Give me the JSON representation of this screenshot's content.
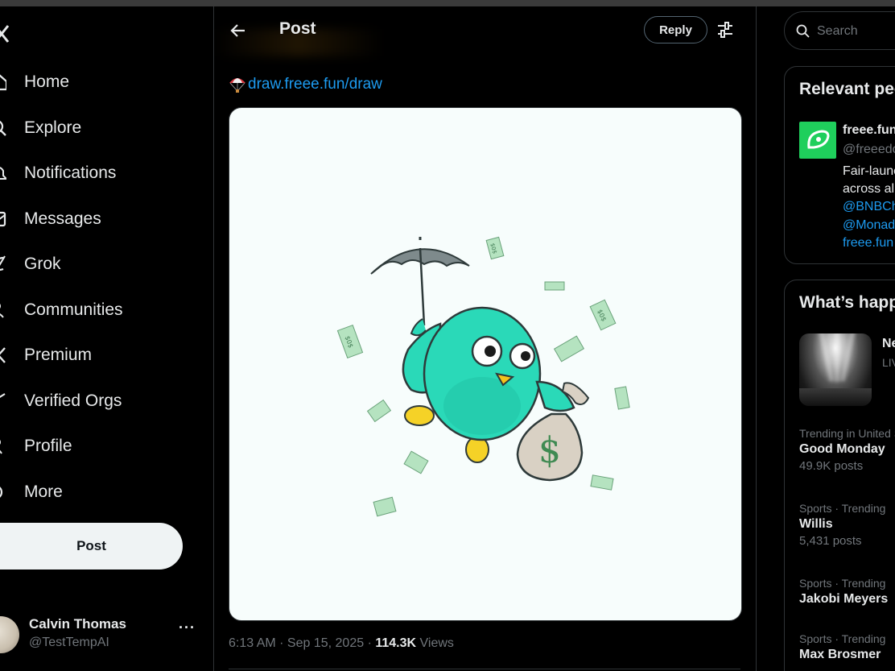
{
  "nav": {
    "items": [
      {
        "label": "Home",
        "icon": "home-icon"
      },
      {
        "label": "Explore",
        "icon": "search-icon"
      },
      {
        "label": "Notifications",
        "icon": "bell-icon"
      },
      {
        "label": "Messages",
        "icon": "envelope-icon"
      },
      {
        "label": "Grok",
        "icon": "grok-icon"
      },
      {
        "label": "Communities",
        "icon": "people-icon"
      },
      {
        "label": "Premium",
        "icon": "x-logo-icon"
      },
      {
        "label": "Verified Orgs",
        "icon": "lightning-icon"
      },
      {
        "label": "Profile",
        "icon": "person-icon"
      },
      {
        "label": "More",
        "icon": "more-circle-icon"
      }
    ],
    "post_label": "Post"
  },
  "account": {
    "name": "Calvin Thomas",
    "handle": "@TestTempAI",
    "more": "···"
  },
  "header": {
    "title": "Post",
    "reply_label": "Reply"
  },
  "post": {
    "link_text": "draw.freee.fun/draw",
    "time": "6:13 AM · Sep 15, 2025 · ",
    "views_count": "114.3K",
    "views_label": " Views",
    "bill_text": "$0$"
  },
  "search": {
    "placeholder": "Search"
  },
  "relevant": {
    "title": "Relevant people",
    "name": "freee.fun",
    "handle": "@freeedotfun",
    "bio_line1": "Fair-launch tokens",
    "bio_line2": "across all chains",
    "mention1": "@BNBChain",
    "mention2": "@Monad",
    "link": "freee.fun"
  },
  "happening": {
    "title": "What’s happening",
    "live_title": "New York Fashion Week",
    "live_sub": "LIVE",
    "trends": [
      {
        "context": "Trending in United States",
        "name": "Good Monday",
        "count": "49.9K posts"
      },
      {
        "context": "Sports · Trending",
        "name": "Willis",
        "count": "5,431 posts"
      },
      {
        "context": "Sports · Trending",
        "name": "Jakobi Meyers",
        "count": ""
      },
      {
        "context": "Sports · Trending",
        "name": "Max Brosmer",
        "count": ""
      }
    ]
  },
  "colors": {
    "background": "#000000",
    "text": "#e7e9ea",
    "muted": "#71767b",
    "link": "#1d9bf0",
    "border": "#2f3336",
    "bird": "#25d6b4",
    "brand_green": "#1fcf5c"
  }
}
